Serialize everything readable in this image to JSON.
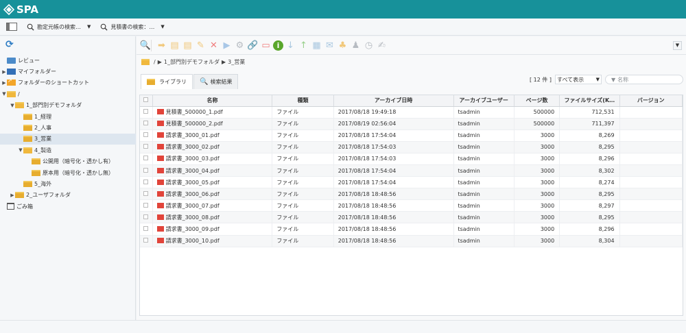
{
  "app": {
    "title": "SPA",
    "colors": {
      "brand": "#17919a",
      "pdf": "#e1443a"
    }
  },
  "search_bar": {
    "items": [
      {
        "icon": "search-icon",
        "label": "勘定元帳の検索…"
      },
      {
        "icon": "search-icon",
        "label": "見積書の検索：…"
      }
    ]
  },
  "tree": [
    {
      "label": "レビュー",
      "icon": "review-icon",
      "indent": 0,
      "arrow": ""
    },
    {
      "label": "マイフォルダー",
      "icon": "my-folder-icon",
      "indent": 0,
      "arrow": "▶"
    },
    {
      "label": "フォルダーのショートカット",
      "icon": "shortcut-folder-icon",
      "indent": 0,
      "arrow": "▶"
    },
    {
      "label": "/",
      "icon": "folder-open-icon",
      "indent": 0,
      "arrow": "▼"
    },
    {
      "label": "1_部門別デモフォルダ",
      "icon": "folder-open-icon",
      "indent": 1,
      "arrow": "▼"
    },
    {
      "label": "1_経理",
      "icon": "folder-icon",
      "indent": 2,
      "arrow": ""
    },
    {
      "label": "2_人事",
      "icon": "folder-icon",
      "indent": 2,
      "arrow": ""
    },
    {
      "label": "3_営業",
      "icon": "folder-icon",
      "indent": 2,
      "arrow": "",
      "selected": true
    },
    {
      "label": "4_製造",
      "icon": "folder-open-icon",
      "indent": 2,
      "arrow": "▼"
    },
    {
      "label": "公開用（暗号化・透かし有）",
      "icon": "folder-icon",
      "indent": 3,
      "arrow": ""
    },
    {
      "label": "原本用（暗号化・透かし無）",
      "icon": "folder-icon",
      "indent": 3,
      "arrow": ""
    },
    {
      "label": "5_海外",
      "icon": "folder-icon",
      "indent": 2,
      "arrow": ""
    },
    {
      "label": "2_ユーザフォルダ",
      "icon": "folder-icon",
      "indent": 1,
      "arrow": "▶"
    },
    {
      "label": "ごみ箱",
      "icon": "trash-icon",
      "indent": 0,
      "arrow": ""
    }
  ],
  "toolbar": {
    "tools": [
      {
        "name": "search-icon",
        "glyph": "🔍",
        "class": "c-search"
      },
      {
        "name": "move-icon",
        "glyph": "➡",
        "class": "c-orange"
      },
      {
        "name": "copy-icon",
        "glyph": "▤",
        "class": "c-orange"
      },
      {
        "name": "paste-icon",
        "glyph": "▤",
        "class": "c-orange"
      },
      {
        "name": "edit-icon",
        "glyph": "✎",
        "class": "c-orange"
      },
      {
        "name": "delete-icon",
        "glyph": "✕",
        "class": "c-red"
      },
      {
        "name": "play-icon",
        "glyph": "▶",
        "class": "c-blue"
      },
      {
        "name": "settings-icon",
        "glyph": "⚙",
        "class": "c-gray"
      },
      {
        "name": "link-icon",
        "glyph": "🔗",
        "class": "c-gray"
      },
      {
        "name": "redact-icon",
        "glyph": "▭",
        "class": "c-red"
      },
      {
        "name": "info-icon",
        "glyph": "i",
        "class": "c-info"
      },
      {
        "name": "download-icon",
        "glyph": "↓",
        "class": "c-light"
      },
      {
        "name": "upload-icon",
        "glyph": "↑",
        "class": "c-greenlt"
      },
      {
        "name": "layout-icon",
        "glyph": "▦",
        "class": "c-light"
      },
      {
        "name": "mail-icon",
        "glyph": "✉",
        "class": "c-light"
      },
      {
        "name": "stamp-icon",
        "glyph": "♣",
        "class": "c-orange"
      },
      {
        "name": "user-icon",
        "glyph": "♟",
        "class": "c-gray"
      },
      {
        "name": "clock-icon",
        "glyph": "◷",
        "class": "c-gray"
      },
      {
        "name": "sign-icon",
        "glyph": "✍",
        "class": "c-gray"
      }
    ]
  },
  "breadcrumb": {
    "root": "/",
    "parts": [
      "1_部門別デモフォルダ",
      "3_営業"
    ]
  },
  "tabs": [
    {
      "label": "ライブラリ",
      "active": true
    },
    {
      "label": "検索結果",
      "active": false
    }
  ],
  "filters": {
    "count": "[ 12 件 ]",
    "select": "すべて表示",
    "name_placeholder": "名称"
  },
  "table": {
    "columns": [
      "名称",
      "種類",
      "アーカイブ日時",
      "アーカイブユーザー",
      "ページ数",
      "ファイルサイズ(K…",
      "バージョン"
    ],
    "rows": [
      [
        "見積書_500000_1.pdf",
        "ファイル",
        "2017/08/18 19:49:18",
        "tsadmin",
        "500000",
        "712,531",
        ""
      ],
      [
        "見積書_500000_2.pdf",
        "ファイル",
        "2017/08/19 02:56:04",
        "tsadmin",
        "500000",
        "711,397",
        ""
      ],
      [
        "請求書_3000_01.pdf",
        "ファイル",
        "2017/08/18 17:54:04",
        "tsadmin",
        "3000",
        "8,269",
        ""
      ],
      [
        "請求書_3000_02.pdf",
        "ファイル",
        "2017/08/18 17:54:03",
        "tsadmin",
        "3000",
        "8,295",
        ""
      ],
      [
        "請求書_3000_03.pdf",
        "ファイル",
        "2017/08/18 17:54:03",
        "tsadmin",
        "3000",
        "8,296",
        ""
      ],
      [
        "請求書_3000_04.pdf",
        "ファイル",
        "2017/08/18 17:54:04",
        "tsadmin",
        "3000",
        "8,302",
        ""
      ],
      [
        "請求書_3000_05.pdf",
        "ファイル",
        "2017/08/18 17:54:04",
        "tsadmin",
        "3000",
        "8,274",
        ""
      ],
      [
        "請求書_3000_06.pdf",
        "ファイル",
        "2017/08/18 18:48:56",
        "tsadmin",
        "3000",
        "8,295",
        ""
      ],
      [
        "請求書_3000_07.pdf",
        "ファイル",
        "2017/08/18 18:48:56",
        "tsadmin",
        "3000",
        "8,297",
        ""
      ],
      [
        "請求書_3000_08.pdf",
        "ファイル",
        "2017/08/18 18:48:56",
        "tsadmin",
        "3000",
        "8,295",
        ""
      ],
      [
        "請求書_3000_09.pdf",
        "ファイル",
        "2017/08/18 18:48:56",
        "tsadmin",
        "3000",
        "8,296",
        ""
      ],
      [
        "請求書_3000_10.pdf",
        "ファイル",
        "2017/08/18 18:48:56",
        "tsadmin",
        "3000",
        "8,304",
        ""
      ]
    ]
  }
}
